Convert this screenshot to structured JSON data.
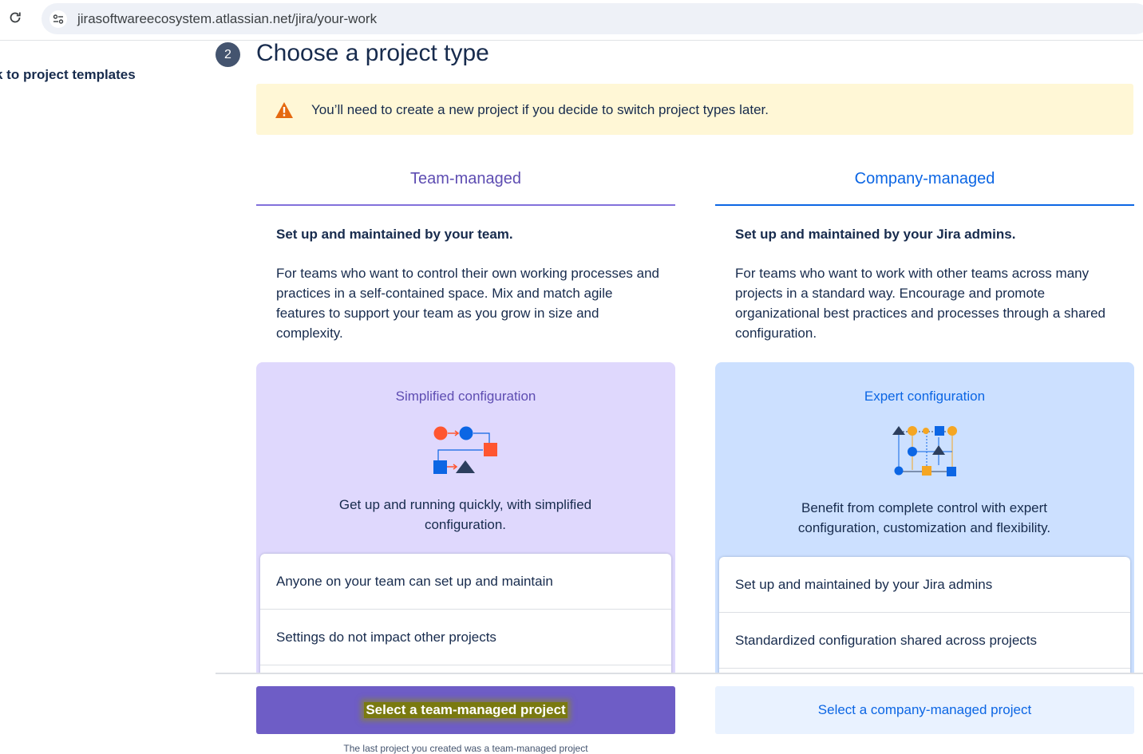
{
  "browser": {
    "url": "jirasoftwareecosystem.atlassian.net/jira/your-work"
  },
  "nav": {
    "back_label": "k to project templates"
  },
  "header": {
    "step_number": "2",
    "title": "Choose a project type"
  },
  "warning": {
    "text": "You’ll need to create a new project if you decide to switch project types later."
  },
  "team_managed": {
    "tab_label": "Team-managed",
    "lead": "Set up and maintained by your team.",
    "description": "For teams who want to control their own working processes and practices in a self-contained space. Mix and match agile features to support your team as you grow in size and complexity.",
    "card_title": "Simplified configuration",
    "card_text": "Get up and running quickly, with simplified configuration.",
    "features": [
      "Anyone on your team can set up and maintain",
      "Settings do not impact other projects"
    ],
    "button_label": "Select a team-managed project",
    "footnote": "The last project you created was a team-managed project"
  },
  "company_managed": {
    "tab_label": "Company-managed",
    "lead": "Set up and maintained by your Jira admins.",
    "description": "For teams who want to work with other teams across many projects in a standard way. Encourage and promote organizational best practices and processes through a shared configuration.",
    "card_title": "Expert configuration",
    "card_text": "Benefit from complete control with expert configuration, customization and flexibility.",
    "features": [
      "Set up and maintained by your Jira admins",
      "Standardized configuration shared across projects"
    ],
    "button_label": "Select a company-managed project"
  },
  "colors": {
    "team_accent": "#5e4db2",
    "team_button": "#6e5dc6",
    "company_accent": "#0c66e4",
    "warning_bg": "#fff7d6",
    "warning_icon": "#e56910"
  },
  "icons": {
    "reload": "reload-icon",
    "site_info": "site-settings-icon",
    "warning": "warning-triangle-icon"
  }
}
